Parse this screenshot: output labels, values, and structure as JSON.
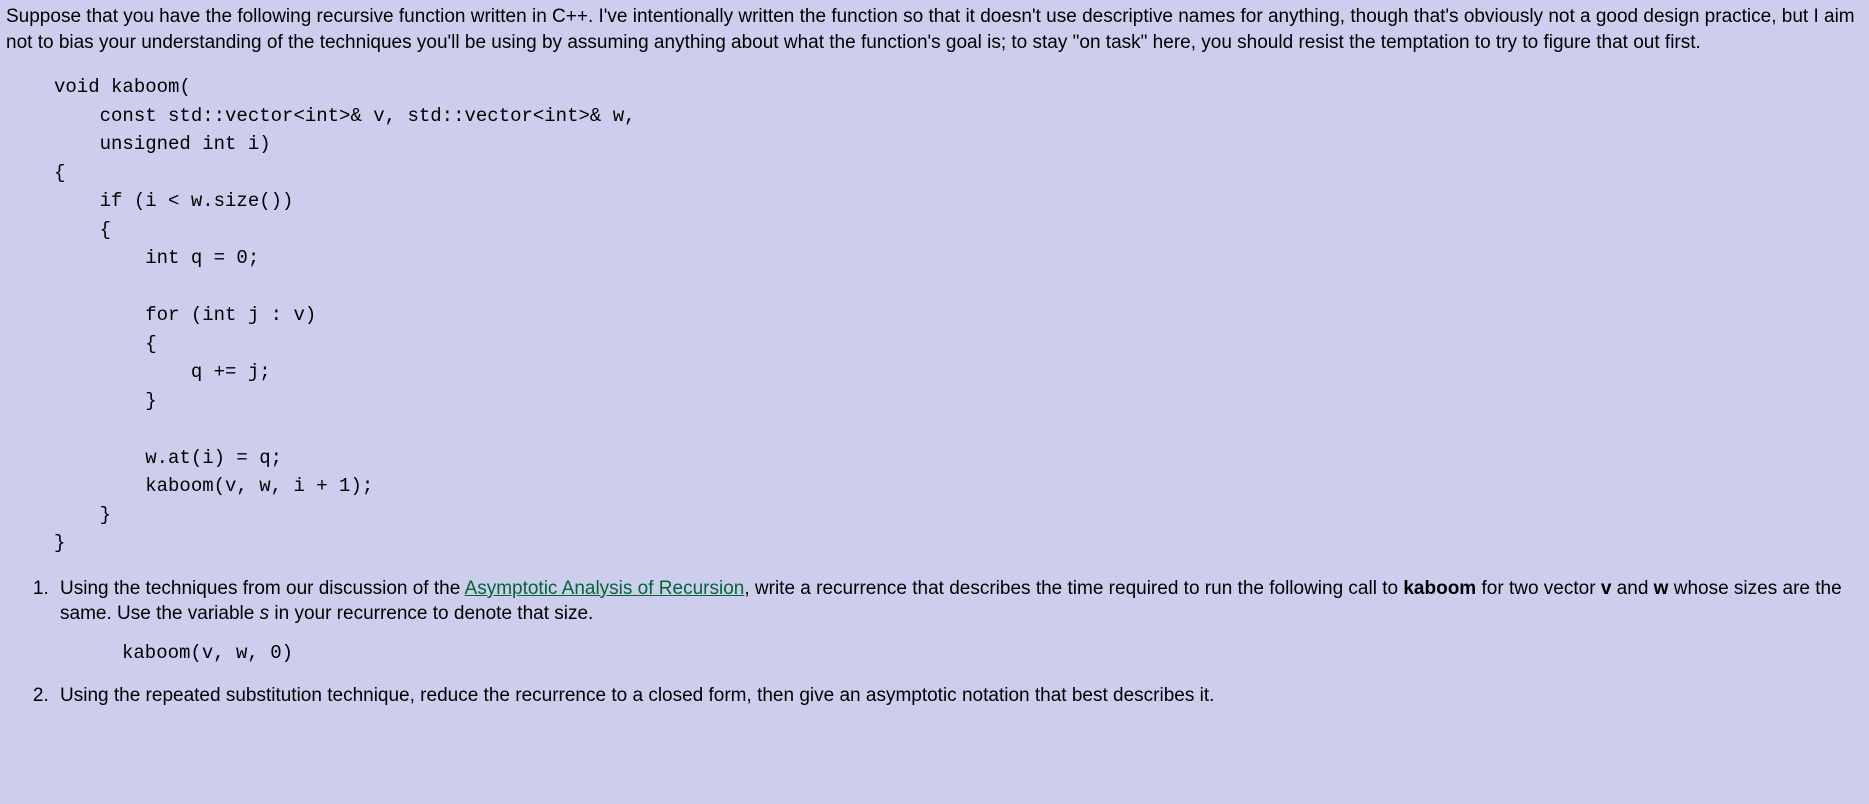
{
  "intro": "Suppose that you have the following recursive function written in C++. I've intentionally written the function so that it doesn't use descriptive names for anything, though that's obviously not a good design practice, but I aim not to bias your understanding of the techniques you'll be using by assuming anything about what the function's goal is; to stay \"on task\" here, you should resist the temptation to try to figure that out first.",
  "code": "void kaboom(\n    const std::vector<int>& v, std::vector<int>& w,\n    unsigned int i)\n{\n    if (i < w.size())\n    {\n        int q = 0;\n\n        for (int j : v)\n        {\n            q += j;\n        }\n\n        w.at(i) = q;\n        kaboom(v, w, i + 1);\n    }\n}",
  "q1": {
    "pre": "Using the techniques from our discussion of the ",
    "link_text": "Asymptotic Analysis of Recursion",
    "post_link": ", write a recurrence that describes the time required to run the following call to ",
    "kaboom": "kaboom",
    "after_kaboom": " for two vector ",
    "v": "v",
    "mid": " and ",
    "w": "w",
    "after_vw": " whose sizes are the same. Use the variable ",
    "s": "s",
    "tail": " in your recurrence to denote that size.",
    "call": "kaboom(v, w, 0)"
  },
  "q2": "Using the repeated substitution technique, reduce the recurrence to a closed form, then give an asymptotic notation that best describes it."
}
